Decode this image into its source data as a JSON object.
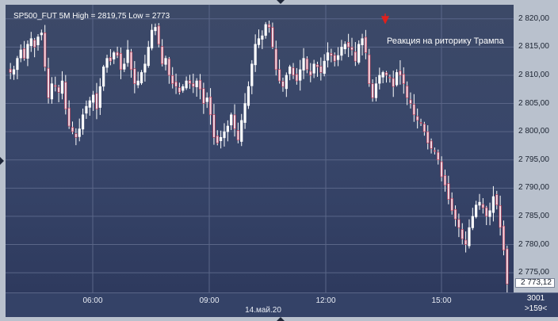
{
  "header": {
    "title": "SP500_FUT 5M High = 2819,75 Low = 2773"
  },
  "annotation": {
    "text": "Реакция на риторику Трампа",
    "arrow_icon": "red-down-arrow-icon",
    "arrow_color": "#e0201c"
  },
  "price_axis": {
    "ticks": [
      "2 820,00",
      "2 815,00",
      "2 810,00",
      "2 805,00",
      "2 800,00",
      "2 795,00",
      "2 790,00",
      "2 785,00",
      "2 780,00",
      "2 775,00"
    ],
    "last_price_label": "2 773,12"
  },
  "time_axis": {
    "ticks": [
      "06:00",
      "09:00",
      "12:00",
      "15:00"
    ],
    "date_label": "14.май.20"
  },
  "corner": {
    "bar_count": "3001",
    "scroll_label": ">159<"
  },
  "colors": {
    "background": "#38466a",
    "up_candle": "#ffffff",
    "down_candle": "#f0dde6",
    "grid": "#5a6688",
    "wick": "#ffffff"
  },
  "chart_data": {
    "type": "candlestick",
    "title": "SP500_FUT 5M",
    "timeframe": "5M",
    "high": 2819.75,
    "low": 2773,
    "ylim": [
      2771.5,
      2822.5
    ],
    "y_ticks": [
      2820,
      2815,
      2810,
      2805,
      2800,
      2795,
      2790,
      2785,
      2780,
      2775
    ],
    "x_ticks": [
      "06:00",
      "09:00",
      "12:00",
      "15:00"
    ],
    "date": "14.май.20",
    "last_price": 2773.12,
    "close_path": [
      2810.5,
      2811.0,
      2813.0,
      2814.5,
      2813.0,
      2815.5,
      2816.5,
      2815.0,
      2816.8,
      2817.5,
      2811.5,
      2806.0,
      2808.5,
      2808.0,
      2807.0,
      2809.0,
      2804.0,
      2801.0,
      2800.0,
      2799.0,
      2800.5,
      2803.0,
      2804.5,
      2805.5,
      2806.5,
      2804.0,
      2808.0,
      2811.5,
      2813.0,
      2812.5,
      2814.0,
      2813.5,
      2811.0,
      2812.0,
      2814.5,
      2811.0,
      2808.5,
      2809.0,
      2810.5,
      2812.0,
      2815.0,
      2818.0,
      2818.5,
      2815.5,
      2812.0,
      2813.0,
      2810.0,
      2808.5,
      2808.0,
      2807.0,
      2808.0,
      2809.0,
      2808.5,
      2808.0,
      2809.0,
      2807.5,
      2805.0,
      2806.0,
      2803.0,
      2799.0,
      2798.0,
      2799.0,
      2800.0,
      2801.0,
      2803.0,
      2800.5,
      2798.5,
      2802.0,
      2805.0,
      2808.0,
      2812.0,
      2815.5,
      2816.5,
      2817.0,
      2819.0,
      2818.5,
      2815.0,
      2811.0,
      2809.0,
      2808.0,
      2810.0,
      2811.5,
      2810.0,
      2809.0,
      2811.0,
      2813.0,
      2811.0,
      2810.0,
      2812.0,
      2811.5,
      2810.5,
      2812.5,
      2814.0,
      2813.5,
      2812.5,
      2813.5,
      2815.0,
      2815.5,
      2815.0,
      2814.5,
      2812.5,
      2815.5,
      2816.5,
      2814.0,
      2808.5,
      2806.0,
      2808.5,
      2810.0,
      2810.5,
      2810.0,
      2809.5,
      2808.0,
      2810.5,
      2810.0,
      2808.5,
      2806.0,
      2805.0,
      2803.0,
      2802.0,
      2801.5,
      2800.0,
      2798.0,
      2797.0,
      2796.5,
      2795.0,
      2792.0,
      2790.5,
      2788.0,
      2786.0,
      2784.5,
      2783.0,
      2781.0,
      2780.0,
      2783.0,
      2785.0,
      2787.0,
      2787.5,
      2786.5,
      2785.0,
      2786.0,
      2788.5,
      2787.0,
      2783.0,
      2779.0,
      2773.0
    ]
  }
}
